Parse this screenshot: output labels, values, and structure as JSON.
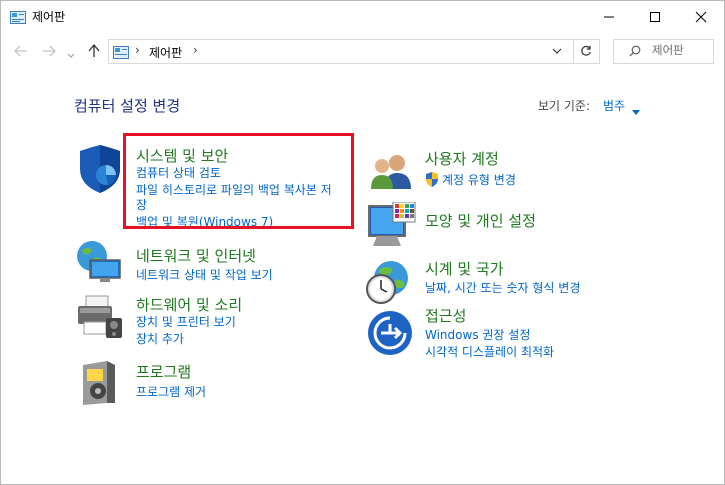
{
  "window": {
    "title": "제어판"
  },
  "address": {
    "current": "제어판"
  },
  "search": {
    "placeholder": "제어판"
  },
  "heading": "컴퓨터 설정 변경",
  "view_by": {
    "label": "보기 기준:",
    "value": "범주"
  },
  "categories": {
    "system": {
      "title": "시스템 및 보안",
      "links": [
        "컴퓨터 상태 검토",
        "파일 히스토리로 파일의 백업 복사본 저",
        "장",
        "백업 및 복원(Windows 7)"
      ]
    },
    "network": {
      "title": "네트워크 및 인터넷",
      "links": [
        "네트워크 상태 및 작업 보기"
      ]
    },
    "hardware": {
      "title": "하드웨어 및 소리",
      "links": [
        "장치 및 프린터 보기",
        "장치 추가"
      ]
    },
    "programs": {
      "title": "프로그램",
      "links": [
        "프로그램 제거"
      ]
    },
    "users": {
      "title": "사용자 계정",
      "links": [
        "계정 유형 변경"
      ]
    },
    "appearance": {
      "title": "모양 및 개인 설정",
      "links": []
    },
    "clock": {
      "title": "시계 및 국가",
      "links": [
        "날짜, 시간 또는 숫자 형식 변경"
      ]
    },
    "ease": {
      "title": "접근성",
      "links": [
        "Windows 권장 설정",
        "시각적 디스플레이 최적화"
      ]
    }
  },
  "colors": {
    "title_green": "#1e7a1e",
    "link_blue": "#0066cc",
    "heading_navy": "#1e3287",
    "highlight_red": "#e81123"
  }
}
